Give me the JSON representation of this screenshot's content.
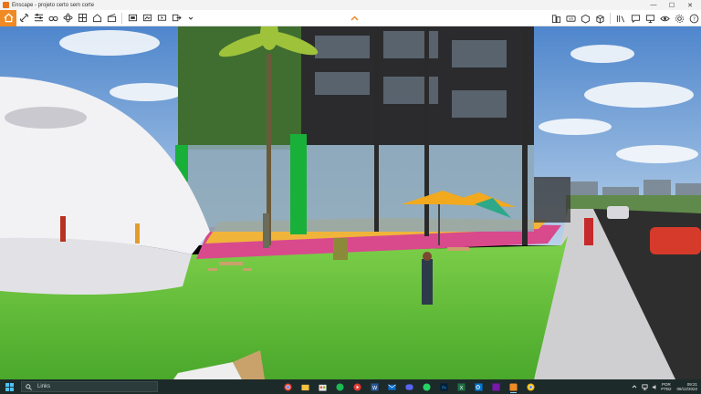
{
  "window": {
    "title": "Enscape - projeto certo sem corte",
    "minimize": "—",
    "maximize": "☐",
    "close": "✕"
  },
  "toolbar": {
    "left_icons": [
      "home-icon",
      "link-icon",
      "sliders-icon",
      "binoculars-icon",
      "atom-icon",
      "grid-icon",
      "house-icon",
      "clapperboard-icon",
      "screenshot-icon",
      "panorama-icon",
      "video-export-icon",
      "export-icon"
    ],
    "center_icon": "chevron-up-icon",
    "right_icons": [
      "building-icon",
      "vr-icon",
      "asset-icon",
      "cube-icon",
      "library-icon",
      "feedback-icon",
      "monitor-icon",
      "eye-icon",
      "settings-icon",
      "help-icon"
    ],
    "accent": "#f08a24"
  },
  "scene": {
    "description_free": true,
    "sky_color": "#6f9fd8",
    "grass_color": "#5fc23a"
  },
  "taskbar": {
    "search_placeholder": "Links",
    "apps": [
      "chrome-icon",
      "file-explorer-icon",
      "store-icon",
      "spotify-icon",
      "cast-icon",
      "word-icon",
      "mail-icon",
      "discord-icon",
      "whatsapp-icon",
      "photoshop-icon",
      "excel-icon",
      "outlook-icon",
      "onenote-icon",
      "enscape-icon",
      "chrome-alt-icon"
    ],
    "tray_lang_1": "POR",
    "tray_lang_2": "PTB2",
    "time": "09:21",
    "date": "08/12/2022"
  }
}
